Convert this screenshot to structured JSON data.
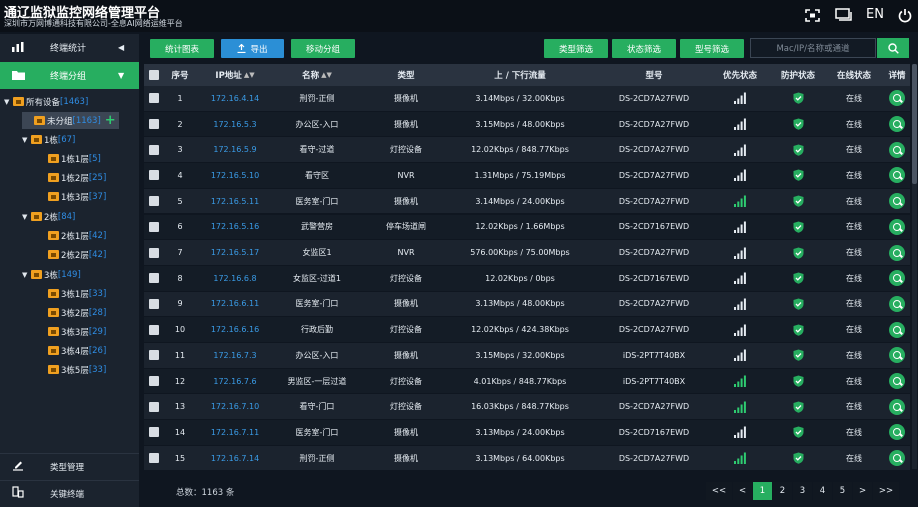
{
  "header": {
    "title": "通辽监狱监控网络管理平台",
    "subtitle": "深圳市万网博通科技有限公司-全息AI网络运维平台",
    "lang": "EN"
  },
  "sidebar": {
    "tab_stats": "终端统计",
    "tab_group": "终端分组",
    "tree": [
      {
        "name": "所有设备",
        "count": "[1463]"
      },
      {
        "name": "未分组",
        "count": "[1163]"
      },
      {
        "name": "1栋",
        "count": "[67]"
      },
      {
        "name": "1栋1层",
        "count": "[5]"
      },
      {
        "name": "1栋2层",
        "count": "[25]"
      },
      {
        "name": "1栋3层",
        "count": "[37]"
      },
      {
        "name": "2栋",
        "count": "[84]"
      },
      {
        "name": "2栋1层",
        "count": "[42]"
      },
      {
        "name": "2栋2层",
        "count": "[42]"
      },
      {
        "name": "3栋",
        "count": "[149]"
      },
      {
        "name": "3栋1层",
        "count": "[33]"
      },
      {
        "name": "3栋2层",
        "count": "[28]"
      },
      {
        "name": "3栋3层",
        "count": "[29]"
      },
      {
        "name": "3栋4层",
        "count": "[26]"
      },
      {
        "name": "3栋5层",
        "count": "[33]"
      }
    ],
    "type_mgmt": "类型管理",
    "key_terminal": "关键终端"
  },
  "toolbar": {
    "stats_chart": "统计图表",
    "export": "导出",
    "move_group": "移动分组",
    "type_filter": "类型筛选",
    "status_filter": "状态筛选",
    "model_filter": "型号筛选",
    "search_placeholder": "Mac/IP/名称或通道"
  },
  "table": {
    "headers": {
      "no": "序号",
      "ip": "IP地址",
      "name": "名称",
      "type": "类型",
      "traffic": "上 / 下行流量",
      "model": "型号",
      "priority": "优先状态",
      "protect": "防护状态",
      "online": "在线状态",
      "detail": "详情"
    },
    "rows": [
      {
        "no": "1",
        "ip": "172.16.4.14",
        "name": "刑罚-正侧",
        "type": "摄像机",
        "traffic": "3.14Mbps / 32.00Kbps",
        "model": "DS-2CD7A27FWD",
        "online": "在线",
        "green": false
      },
      {
        "no": "2",
        "ip": "172.16.5.3",
        "name": "办公区-入口",
        "type": "摄像机",
        "traffic": "3.15Mbps / 48.00Kbps",
        "model": "DS-2CD7A27FWD",
        "online": "在线",
        "green": false
      },
      {
        "no": "3",
        "ip": "172.16.5.9",
        "name": "看守-过道",
        "type": "灯控设备",
        "traffic": "12.02Kbps / 848.77Kbps",
        "model": "DS-2CD7A27FWD",
        "online": "在线",
        "green": false
      },
      {
        "no": "4",
        "ip": "172.16.5.10",
        "name": "看守区",
        "type": "NVR",
        "traffic": "1.31Mbps / 75.19Mbps",
        "model": "DS-2CD7A27FWD",
        "online": "在线",
        "green": false
      },
      {
        "no": "5",
        "ip": "172.16.5.11",
        "name": "医务室-门口",
        "type": "摄像机",
        "traffic": "3.14Mbps / 24.00Kbps",
        "model": "DS-2CD7A27FWD",
        "online": "在线",
        "green": true
      },
      {
        "no": "6",
        "ip": "172.16.5.16",
        "name": "武警营房",
        "type": "停车场道闸",
        "traffic": "12.02Kbps / 1.66Mbps",
        "model": "DS-2CD7167EWD",
        "online": "在线",
        "green": false
      },
      {
        "no": "7",
        "ip": "172.16.5.17",
        "name": "女监区1",
        "type": "NVR",
        "traffic": "576.00Kbps / 75.00Mbps",
        "model": "DS-2CD7A27FWD",
        "online": "在线",
        "green": false
      },
      {
        "no": "8",
        "ip": "172.16.6.8",
        "name": "女监区-过道1",
        "type": "灯控设备",
        "traffic": "12.02Kbps / 0bps",
        "model": "DS-2CD7167EWD",
        "online": "在线",
        "green": false
      },
      {
        "no": "9",
        "ip": "172.16.6.11",
        "name": "医务室-门口",
        "type": "摄像机",
        "traffic": "3.13Mbps / 48.00Kbps",
        "model": "DS-2CD7A27FWD",
        "online": "在线",
        "green": false
      },
      {
        "no": "10",
        "ip": "172.16.6.16",
        "name": "行政后勤",
        "type": "灯控设备",
        "traffic": "12.02Kbps / 424.38Kbps",
        "model": "DS-2CD7A27FWD",
        "online": "在线",
        "green": false
      },
      {
        "no": "11",
        "ip": "172.16.7.3",
        "name": "办公区-入口",
        "type": "摄像机",
        "traffic": "3.15Mbps / 32.00Kbps",
        "model": "iDS-2PT7T40BX",
        "online": "在线",
        "green": false
      },
      {
        "no": "12",
        "ip": "172.16.7.6",
        "name": "男监区-一层过道",
        "type": "灯控设备",
        "traffic": "4.01Kbps / 848.77Kbps",
        "model": "iDS-2PT7T40BX",
        "online": "在线",
        "green": true
      },
      {
        "no": "13",
        "ip": "172.16.7.10",
        "name": "看守-门口",
        "type": "灯控设备",
        "traffic": "16.03Kbps / 848.77Kbps",
        "model": "DS-2CD7A27FWD",
        "online": "在线",
        "green": true
      },
      {
        "no": "14",
        "ip": "172.16.7.11",
        "name": "医务室-门口",
        "type": "摄像机",
        "traffic": "3.13Mbps / 24.00Kbps",
        "model": "DS-2CD7167EWD",
        "online": "在线",
        "green": false
      },
      {
        "no": "15",
        "ip": "172.16.7.14",
        "name": "刑罚-正侧",
        "type": "摄像机",
        "traffic": "3.13Mbps / 64.00Kbps",
        "model": "DS-2CD7A27FWD",
        "online": "在线",
        "green": true
      }
    ]
  },
  "footer": {
    "total": "总数：1163 条",
    "pages": [
      "<<",
      "<",
      "1",
      "2",
      "3",
      "4",
      "5",
      ">",
      ">>"
    ],
    "current": "1"
  },
  "colors": {
    "accent": "#27ae60",
    "link": "#3a9be6",
    "count": "#2f8de4",
    "folder": "#f0a020"
  }
}
